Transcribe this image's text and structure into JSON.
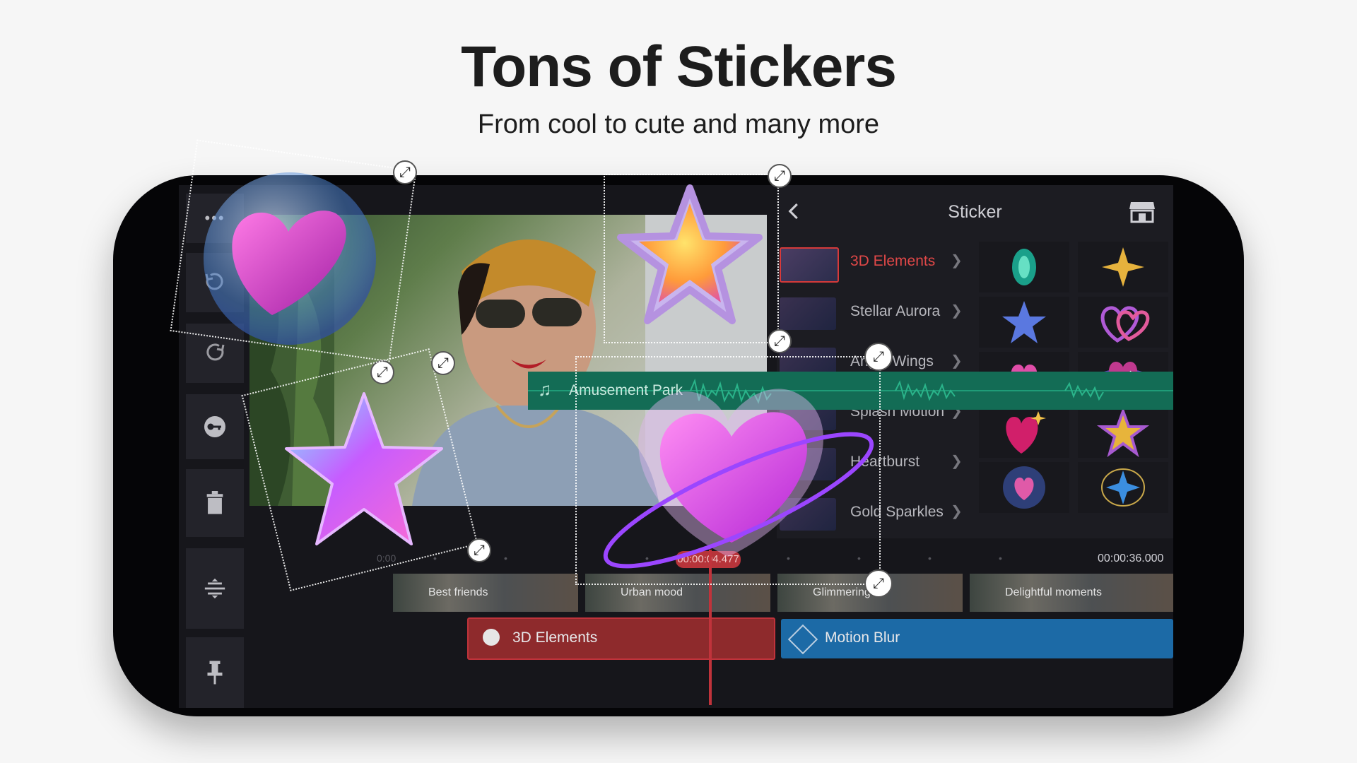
{
  "headline": "Tons of Stickers",
  "subhead": "From cool to cute and many more",
  "panel": {
    "title": "Sticker",
    "categories": [
      {
        "name": "3D Elements",
        "selected": true
      },
      {
        "name": "Stellar Aurora",
        "selected": false
      },
      {
        "name": "Angel Wings",
        "selected": false
      },
      {
        "name": "Splash Motion",
        "selected": false
      },
      {
        "name": "Heartburst",
        "selected": false
      },
      {
        "name": "Gold Sparkles",
        "selected": false
      }
    ]
  },
  "timeline": {
    "current_time": "00:00:04.477",
    "total_time": "00:00:36.000",
    "ruler_start": "0:00",
    "clips": [
      "Best friends",
      "Urban mood",
      "Glimmering",
      "Delightful moments"
    ],
    "sticker_track": "3D Elements",
    "effect_track": "Motion Blur",
    "audio_track": "Amusement Park"
  },
  "icons": {
    "back": "chevron-left-icon",
    "store": "store-icon",
    "undo": "undo-icon",
    "redo": "redo-icon",
    "keyframe": "key-icon",
    "delete": "trash-icon",
    "split": "split-icon",
    "pin": "pin-icon"
  },
  "colors": {
    "accent_red": "#c0333b",
    "sticker_track": "#8e2a2c",
    "effect_track": "#1c6aa6",
    "audio_track": "#136c55"
  }
}
